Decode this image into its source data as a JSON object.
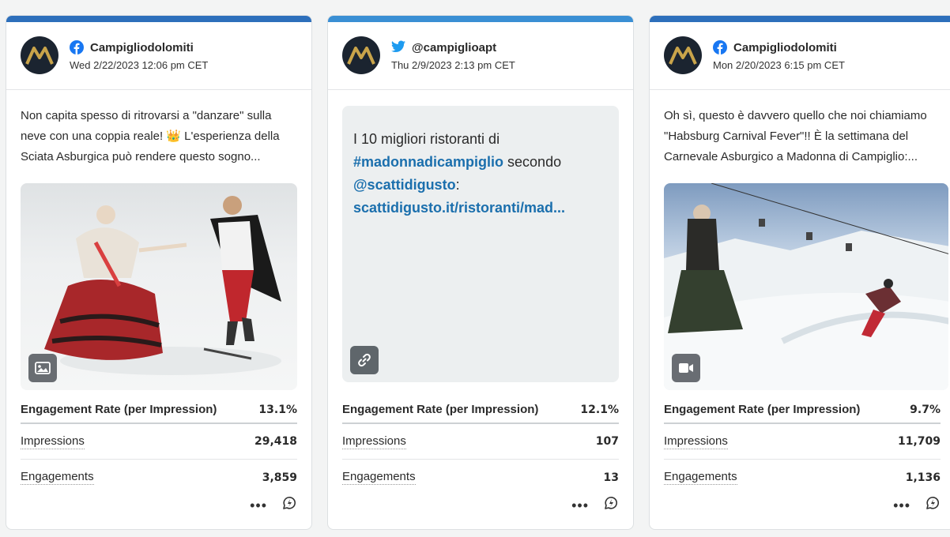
{
  "cards": [
    {
      "network": "facebook",
      "account": "Campigliodolomiti",
      "date": "Wed 2/22/2023 12:06 pm CET",
      "text": "Non capita spesso di ritrovarsi a \"danzare\" sulla neve con una coppia reale! 👑 L'esperienza della Sciata Asburgica può rendere questo sogno...",
      "media_type": "image-icon",
      "engagement_rate_label": "Engagement Rate (per Impression)",
      "engagement_rate": "13.1%",
      "impressions_label": "Impressions",
      "impressions": "29,418",
      "engagements_label": "Engagements",
      "engagements": "3,859"
    },
    {
      "network": "twitter",
      "account": "@campiglioapt",
      "date": "Thu 2/9/2023 2:13 pm CET",
      "text_plain_1": "I 10 migliori ristoranti di",
      "text_hashtag": "#madonnadicampiglio",
      "text_plain_2": " secondo",
      "text_mention": "@scattidigusto",
      "text_colon": ":",
      "text_link": "scattidigusto.it/ristoranti/mad...",
      "media_type": "link-icon",
      "engagement_rate_label": "Engagement Rate (per Impression)",
      "engagement_rate": "12.1%",
      "impressions_label": "Impressions",
      "impressions": "107",
      "engagements_label": "Engagements",
      "engagements": "13"
    },
    {
      "network": "facebook",
      "account": "Campigliodolomiti",
      "date": "Mon 2/20/2023 6:15 pm CET",
      "text": "Oh sì, questo è davvero quello che noi chiamiamo \"Habsburg Carnival Fever\"!! È la settimana del Carnevale Asburgico a Madonna di Campiglio:...",
      "media_type": "video-icon",
      "engagement_rate_label": "Engagement Rate (per Impression)",
      "engagement_rate": "9.7%",
      "impressions_label": "Impressions",
      "impressions": "11,709",
      "engagements_label": "Engagements",
      "engagements": "1,136"
    }
  ],
  "actions": {
    "more": "•••"
  },
  "colors": {
    "facebook": "#1877f2",
    "twitter": "#1d9bf0",
    "link": "#1b6fad",
    "bar_facebook": "#2d6fbb",
    "bar_twitter": "#3a8fd4"
  }
}
